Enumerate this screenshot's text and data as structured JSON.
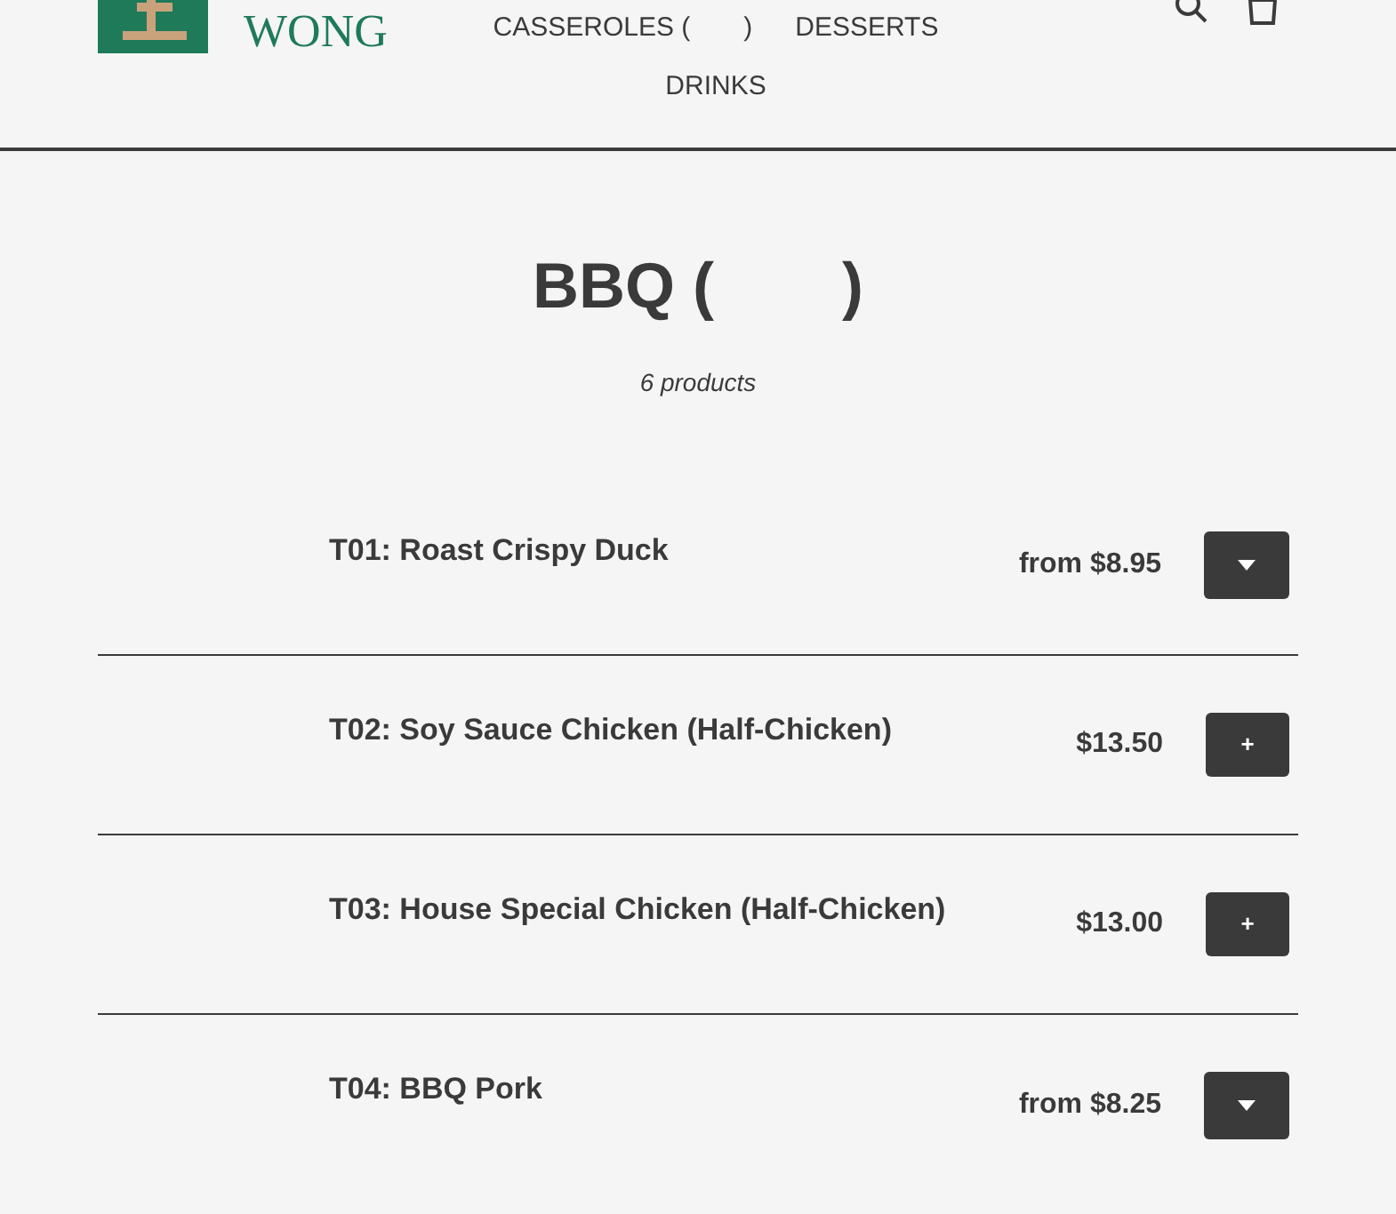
{
  "header": {
    "logo_text": "WONG",
    "nav": [
      {
        "label": "CASSEROLES (　　)"
      },
      {
        "label": "DESSERTS"
      },
      {
        "label": "DRINKS"
      }
    ]
  },
  "collection": {
    "title": "BBQ (　　)",
    "count": "6 products"
  },
  "products": [
    {
      "name": "T01: Roast Crispy Duck",
      "price": "from $8.95",
      "kind": "options"
    },
    {
      "name": "T02: Soy Sauce Chicken (Half-Chicken)",
      "price": "$13.50",
      "kind": "add",
      "button": "+"
    },
    {
      "name": "T03: House Special Chicken (Half-Chicken)",
      "price": "$13.00",
      "kind": "add",
      "button": "+"
    },
    {
      "name": "T04: BBQ Pork",
      "price": "from $8.25",
      "kind": "options"
    }
  ]
}
